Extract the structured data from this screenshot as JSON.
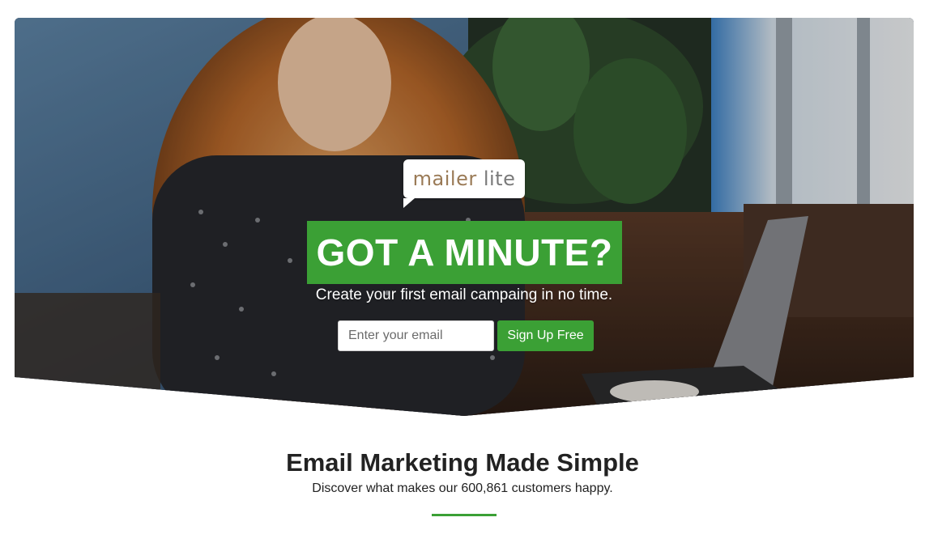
{
  "hero": {
    "logo": {
      "mailer": "mailer",
      "lite": "lite"
    },
    "headline": "GOT A MINUTE?",
    "subline": "Create your first email campaing in no time.",
    "email_placeholder": "Enter your email",
    "signup_label": "Sign Up Free"
  },
  "section": {
    "title": "Email Marketing Made Simple",
    "subtitle": "Discover what makes our 600,861 customers happy."
  },
  "colors": {
    "accent": "#3ba035",
    "text": "#222222"
  }
}
